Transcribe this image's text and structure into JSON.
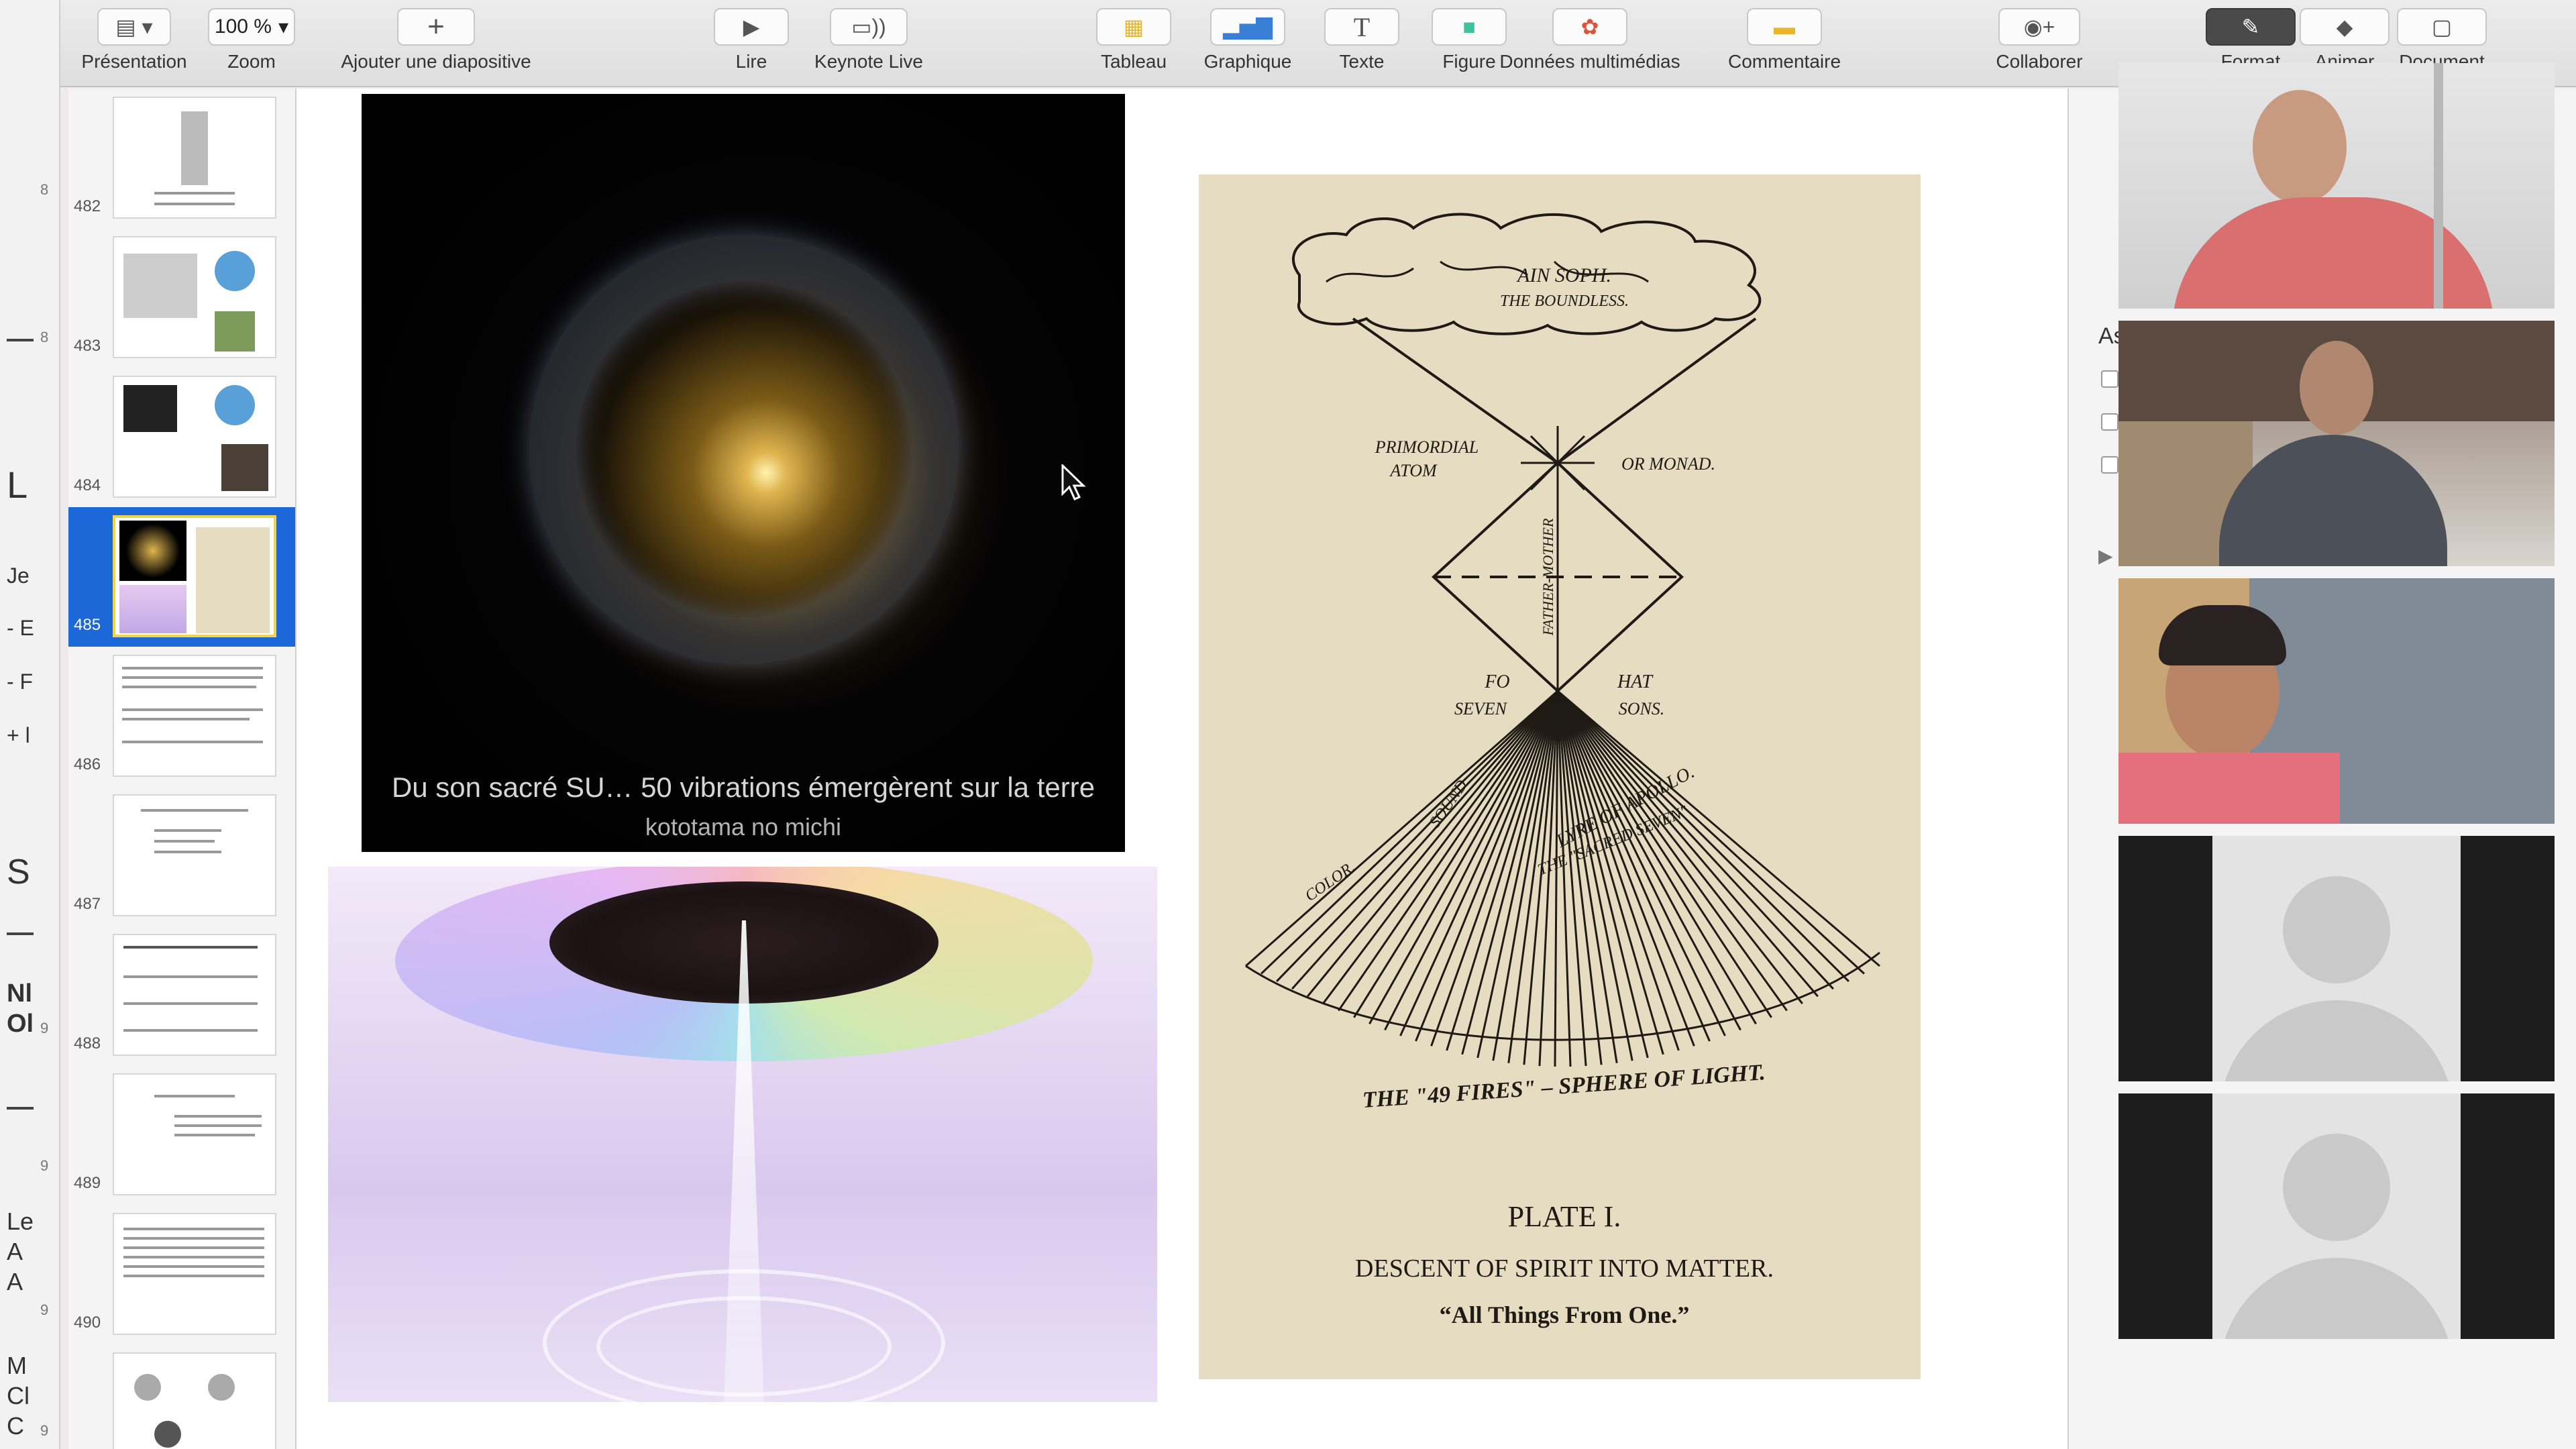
{
  "toolbar": {
    "presentation": "Présentation",
    "zoom_value": "100 %",
    "zoom": "Zoom",
    "add_slide": "Ajouter une diapositive",
    "play": "Lire",
    "keynote_live": "Keynote Live",
    "table": "Tableau",
    "chart": "Graphique",
    "text": "Texte",
    "shape": "Figure",
    "media": "Données multimédias",
    "comment": "Commentaire",
    "collaborate": "Collaborer",
    "format": "Format",
    "animate": "Animer",
    "document": "Document"
  },
  "navigator": {
    "slides": [
      {
        "number": "482"
      },
      {
        "number": "483"
      },
      {
        "number": "484"
      },
      {
        "number": "485",
        "selected": true
      },
      {
        "number": "486"
      },
      {
        "number": "487"
      },
      {
        "number": "488"
      },
      {
        "number": "489"
      },
      {
        "number": "490"
      }
    ]
  },
  "slide": {
    "galaxy_caption_1": "Du son sacré SU… 50 vibrations émergèrent sur la terre",
    "galaxy_caption_2": "kototama no michi",
    "plate": {
      "ain_soph": "AIN SOPH.",
      "boundless": "THE BOUNDLESS.",
      "primordial": "PRIMORDIAL",
      "atom": "ATOM",
      "monad": "OR MONAD.",
      "father_mother": "FATHER-MOTHER",
      "fo": "FO",
      "hat": "HAT",
      "seven": "SEVEN",
      "sons": "SONS.",
      "colour": "COLOR.",
      "sound": "SOUND.",
      "lyre": "LYRE OF APOLLO.",
      "sacred_seven": "THE \"SACRED SEVEN\"",
      "fires": "THE \"49 FIRES\" – SPHERE OF LIGHT.",
      "plate_title": "PLATE I.",
      "descent": "DESCENT OF SPIRIT INTO MATTER.",
      "all_things": "“All Things From One.”"
    }
  },
  "background_app": {
    "fragments": [
      "L",
      "Je",
      "- E",
      "- F",
      "+ l",
      "S",
      "Nl",
      "Ol",
      "Le",
      "A",
      "A",
      "M",
      "Cl",
      "C"
    ],
    "numbers": [
      "8",
      "8",
      "9",
      "9",
      "9",
      "9"
    ]
  },
  "inspector": {
    "fragment": "As"
  }
}
